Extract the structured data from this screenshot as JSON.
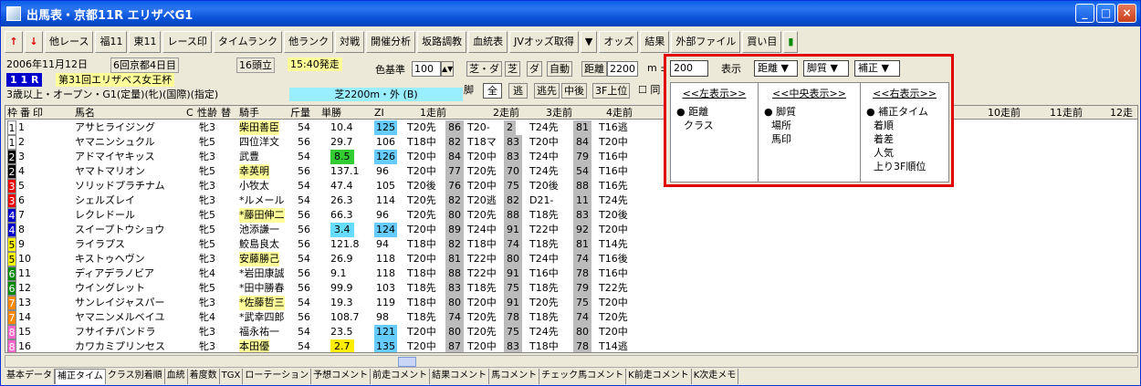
{
  "window": {
    "title": "出馬表・京都11R エリザベG1"
  },
  "toolbar": [
    "他レース",
    "福11",
    "東11",
    "レース印",
    "タイムランク",
    "他ランク",
    "対戦",
    "開催分析",
    "坂路調教",
    "血統表",
    "JVオッズ取得",
    "オッズ",
    "結果",
    "外部ファイル",
    "買い目"
  ],
  "race": {
    "date": "2006年11月12日",
    "kai": "6回京都4日目",
    "heads": "16頭立",
    "time": "15:40発走",
    "rno": "1 1 R",
    "name": "第31回エリザベス女王杯",
    "cond": "3歳以上・オープン・G1(定量)(牝)(国際)(指定)",
    "course": "芝2200m・外 (B)",
    "kijun_label": "色基準",
    "kijun": "100"
  },
  "filter": {
    "surfaces": [
      "芝・ダ",
      "芝",
      "ダ",
      "自動"
    ],
    "dist_label": "距離",
    "dist": "2200",
    "m_label": "m ±",
    "pm": "200",
    "hyoji": "表示",
    "sel1": "距離",
    "sel2": "脚質",
    "sel3": "補正",
    "legs": [
      "脚",
      "全",
      "逃",
      "逃先",
      "中後"
    ],
    "f3": "3F上位",
    "same": "同"
  },
  "popup": {
    "left_title": "<<左表示>>",
    "mid_title": "<<中央表示>>",
    "right_title": "<<右表示>>",
    "left": [
      "● 距離",
      "クラス"
    ],
    "mid": [
      "● 脚質",
      "場所",
      "馬印"
    ],
    "right": [
      "● 補正タイム",
      "着順",
      "着差",
      "人気",
      "上り3F順位"
    ]
  },
  "header": [
    "枠",
    "番",
    "印",
    "馬名",
    "C",
    "性齢",
    "替",
    "騎手",
    "斤量",
    "単勝",
    "ZI",
    "1走前",
    "2走前",
    "3走前",
    "4走前",
    "10走前",
    "11走前",
    "12走"
  ],
  "horses": [
    [
      "1",
      "1",
      "アサヒライジング",
      "牝3",
      "柴田善臣",
      "54",
      "10.4",
      "125",
      "T20先",
      "86",
      "T20-",
      "2",
      "T24先",
      "81",
      "T16逃"
    ],
    [
      "1",
      "2",
      "ヤマニンシュクル",
      "牝5",
      "四位洋文",
      "56",
      "29.7",
      "106",
      "T18中",
      "82",
      "T18マ",
      "83",
      "T20中",
      "84",
      "T20中"
    ],
    [
      "2",
      "3",
      "アドマイヤキッス",
      "牝3",
      "武豊",
      "54",
      "8.5",
      "126",
      "T20中",
      "84",
      "T20中",
      "83",
      "T24中",
      "79",
      "T16中"
    ],
    [
      "2",
      "4",
      "ヤマトマリオン",
      "牝5",
      "幸英明",
      "56",
      "137.1",
      "96",
      "T20中",
      "77",
      "T20先",
      "70",
      "T24先",
      "54",
      "T16中"
    ],
    [
      "3",
      "5",
      "ソリッドプラチナム",
      "牝3",
      "小牧太",
      "54",
      "47.4",
      "105",
      "T20後",
      "76",
      "T20中",
      "75",
      "T20後",
      "88",
      "T16先"
    ],
    [
      "3",
      "6",
      "シェルズレイ",
      "牝3",
      "*ルメール",
      "54",
      "26.3",
      "114",
      "T20先",
      "82",
      "T20逃",
      "82",
      "D21-",
      "11",
      "T24先"
    ],
    [
      "4",
      "7",
      "レクレドール",
      "牝5",
      "*藤田伸二",
      "56",
      "66.3",
      "96",
      "T20先",
      "80",
      "T20先",
      "88",
      "T18先",
      "83",
      "T20後"
    ],
    [
      "4",
      "8",
      "スイープトウショウ",
      "牝5",
      "池添謙一",
      "56",
      "3.4",
      "124",
      "T20中",
      "89",
      "T24中",
      "91",
      "T22中",
      "92",
      "T20中"
    ],
    [
      "5",
      "9",
      "ライラプス",
      "牝5",
      "鮫島良太",
      "56",
      "121.8",
      "94",
      "T18中",
      "82",
      "T18中",
      "74",
      "T18先",
      "81",
      "T14先"
    ],
    [
      "5",
      "10",
      "キストゥヘヴン",
      "牝3",
      "安藤勝己",
      "54",
      "26.9",
      "118",
      "T20中",
      "81",
      "T22中",
      "80",
      "T24中",
      "74",
      "T16後"
    ],
    [
      "6",
      "11",
      "ディアデラノビア",
      "牝4",
      "*岩田康誠",
      "56",
      "9.1",
      "118",
      "T18中",
      "88",
      "T22中",
      "91",
      "T16中",
      "78",
      "T16中"
    ],
    [
      "6",
      "12",
      "ウイングレット",
      "牝5",
      "*田中勝春",
      "56",
      "99.9",
      "103",
      "T18先",
      "83",
      "T18先",
      "75",
      "T18先",
      "79",
      "T22先"
    ],
    [
      "7",
      "13",
      "サンレイジャスパー",
      "牝3",
      "*佐藤哲三",
      "54",
      "19.3",
      "119",
      "T18中",
      "80",
      "T20中",
      "91",
      "T20先",
      "75",
      "T20中"
    ],
    [
      "7",
      "14",
      "ヤマニンメルベイユ",
      "牝4",
      "*武幸四郎",
      "56",
      "108.7",
      "98",
      "T18先",
      "74",
      "T20先",
      "78",
      "T18先",
      "74",
      "T20先"
    ],
    [
      "8",
      "15",
      "フサイチパンドラ",
      "牝3",
      "福永祐一",
      "54",
      "23.5",
      "121",
      "T20中",
      "80",
      "T20先",
      "75",
      "T24先",
      "80",
      "T20中"
    ],
    [
      "8",
      "16",
      "カワカミプリンセス",
      "牝3",
      "本田優",
      "54",
      "2.7",
      "135",
      "T20中",
      "87",
      "T20中",
      "83",
      "T18中",
      "78",
      "T14逃"
    ]
  ],
  "tabs": [
    "基本データ",
    "補正タイム",
    "クラス別着順",
    "血統",
    "着度数",
    "TGX",
    "ローテーション",
    "予想コメント",
    "前走コメント",
    "結果コメント",
    "馬コメント",
    "チェック馬コメント",
    "K前走コメント",
    "K次走メモ"
  ]
}
